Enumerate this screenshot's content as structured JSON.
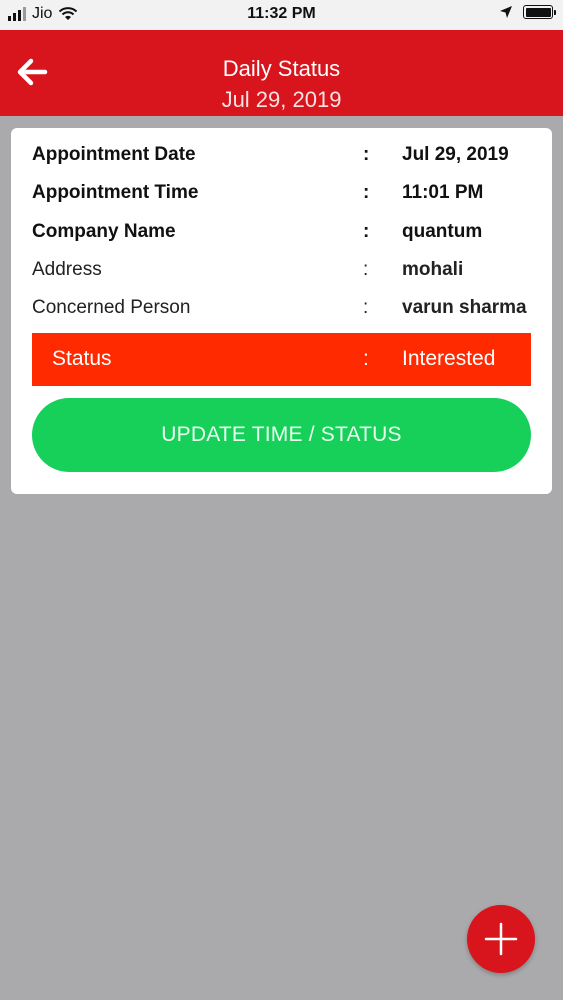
{
  "status_bar": {
    "carrier": "Jio",
    "time": "11:32 PM"
  },
  "header": {
    "title": "Daily Status",
    "subtitle": "Jul 29, 2019"
  },
  "details": [
    {
      "label": "Appointment Date",
      "colon": ":",
      "value": "Jul 29, 2019"
    },
    {
      "label": "Appointment Time",
      "colon": ":",
      "value": "11:01 PM"
    },
    {
      "label": "Company Name",
      "colon": ":",
      "value": "quantum"
    },
    {
      "label": "Address",
      "colon": ":",
      "value": "mohali"
    },
    {
      "label": "Concerned Person",
      "colon": ":",
      "value": "varun sharma"
    }
  ],
  "status": {
    "label": "Status",
    "colon": ":",
    "value": "Interested"
  },
  "actions": {
    "update_label": "UPDATE TIME / STATUS"
  },
  "icons": {
    "back": "arrow-left-icon",
    "fab": "plus-icon",
    "wifi": "wifi-icon",
    "location": "location-arrow-icon",
    "battery": "battery-icon"
  },
  "colors": {
    "header": "#d8141c",
    "status_row": "#ff2a00",
    "update_button": "#16d05a",
    "fab": "#d8141c",
    "background": "#aaa9ab"
  }
}
